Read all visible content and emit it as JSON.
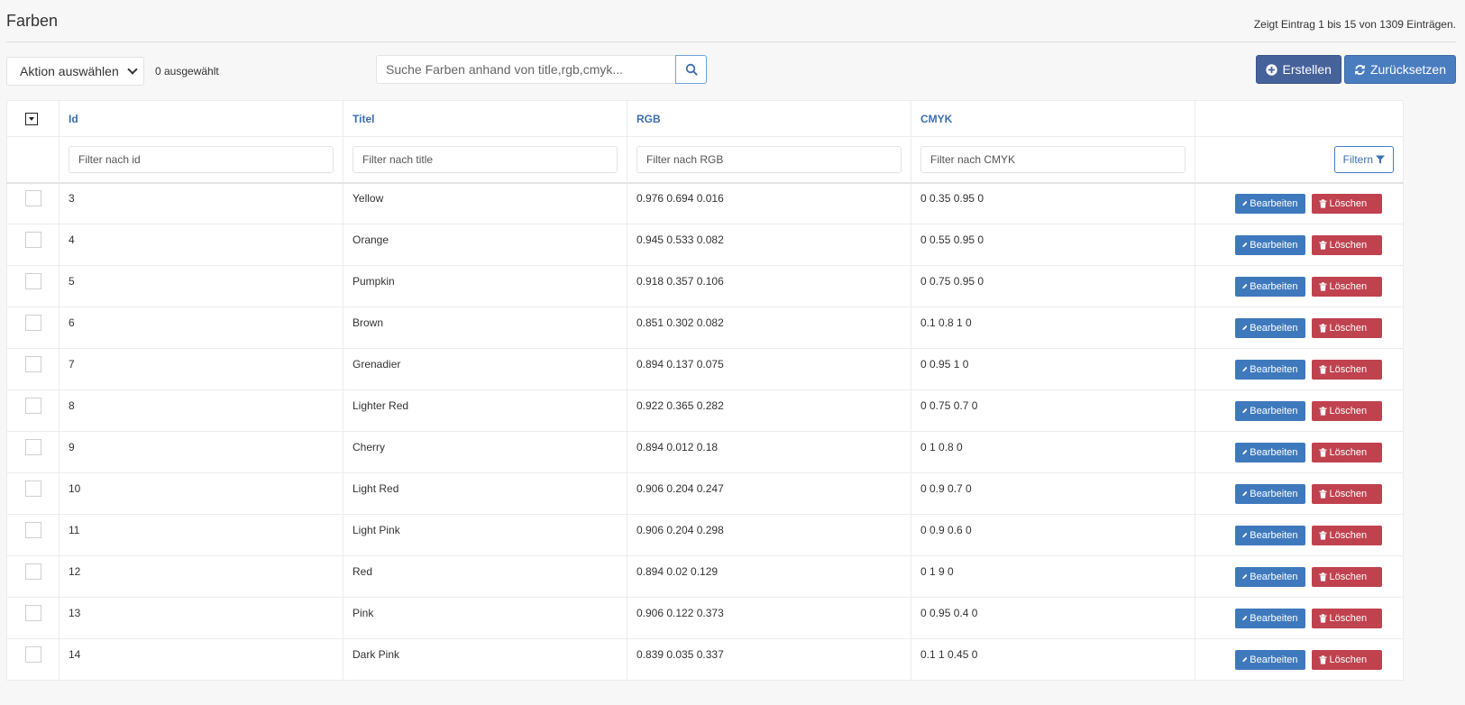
{
  "page": {
    "title": "Farben",
    "pager_info": "Zeigt Eintrag 1 bis 15 von 1309 Einträgen."
  },
  "toolbar": {
    "action_select_value": "Aktion auswählen",
    "selected_count": "0 ausgewählt",
    "search_placeholder": "Suche Farben anhand von title,rgb,cmyk...",
    "create_label": "Erstellen",
    "reset_label": "Zurücksetzen"
  },
  "table": {
    "columns": [
      "Id",
      "Titel",
      "RGB",
      "CMYK"
    ],
    "filters": {
      "id": "Filter nach id",
      "title": "Filter nach title",
      "rgb": "Filter nach RGB",
      "cmyk": "Filter nach CMYK",
      "button": "Filtern"
    },
    "edit_label": "Bearbeiten",
    "delete_label": "Löschen",
    "rows": [
      {
        "id": "3",
        "title": "Yellow",
        "rgb": "0.976 0.694 0.016",
        "cmyk": "0 0.35 0.95 0"
      },
      {
        "id": "4",
        "title": "Orange",
        "rgb": "0.945 0.533 0.082",
        "cmyk": "0 0.55 0.95 0"
      },
      {
        "id": "5",
        "title": "Pumpkin",
        "rgb": "0.918 0.357 0.106",
        "cmyk": "0 0.75 0.95 0"
      },
      {
        "id": "6",
        "title": "Brown",
        "rgb": "0.851 0.302 0.082",
        "cmyk": "0.1 0.8 1 0"
      },
      {
        "id": "7",
        "title": "Grenadier",
        "rgb": "0.894 0.137 0.075",
        "cmyk": "0 0.95 1 0"
      },
      {
        "id": "8",
        "title": "Lighter Red",
        "rgb": "0.922 0.365 0.282",
        "cmyk": "0 0.75 0.7 0"
      },
      {
        "id": "9",
        "title": "Cherry",
        "rgb": "0.894 0.012 0.18",
        "cmyk": "0 1 0.8 0"
      },
      {
        "id": "10",
        "title": "Light Red",
        "rgb": "0.906 0.204 0.247",
        "cmyk": "0 0.9 0.7 0"
      },
      {
        "id": "11",
        "title": "Light Pink",
        "rgb": "0.906 0.204 0.298",
        "cmyk": "0 0.9 0.6 0"
      },
      {
        "id": "12",
        "title": "Red",
        "rgb": "0.894 0.02 0.129",
        "cmyk": "0 1 9 0"
      },
      {
        "id": "13",
        "title": "Pink",
        "rgb": "0.906 0.122 0.373",
        "cmyk": "0 0.95 0.4 0"
      },
      {
        "id": "14",
        "title": "Dark Pink",
        "rgb": "0.839 0.035 0.337",
        "cmyk": "0.1 1 0.45 0"
      }
    ]
  },
  "icons": {
    "search": "search-icon",
    "create": "plus-circle-icon",
    "reset": "refresh-icon",
    "filter": "funnel-icon",
    "edit": "pencil-icon",
    "delete": "trash-icon"
  },
  "colors": {
    "primary": "#4a79b8",
    "link": "#3a6fb0",
    "danger": "#c0424f"
  }
}
